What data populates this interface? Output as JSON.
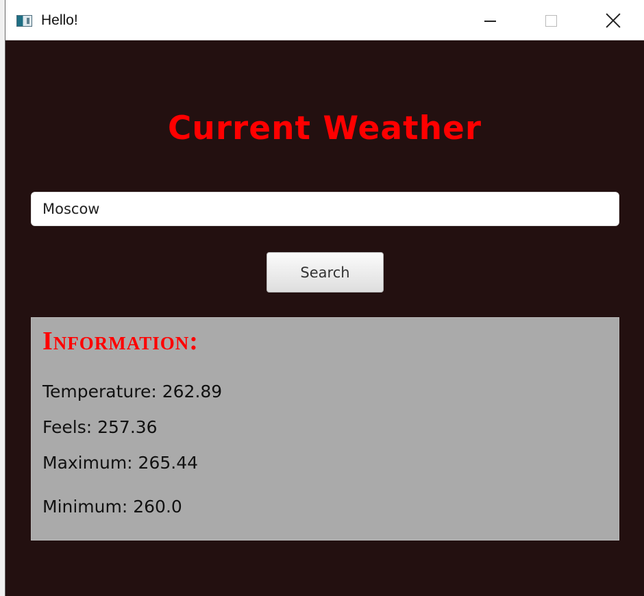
{
  "window": {
    "title": "Hello!",
    "icons": {
      "app": "app-window-icon",
      "minimize": "minimize-icon",
      "maximize": "maximize-icon",
      "close": "close-icon"
    }
  },
  "main": {
    "heading": "Current Weather",
    "search": {
      "value": "Moscow",
      "button_label": "Search"
    },
    "information": {
      "title": "Information:",
      "temperature": "Temperature: 262.89",
      "feels": "Feels: 257.36",
      "maximum": "Maximum: 265.44",
      "minimum": "Minimum: 260.0"
    }
  },
  "colors": {
    "background": "#231010",
    "heading": "#ff0000",
    "panel": "#aaaaaa",
    "title_bar": "#ffffff"
  }
}
